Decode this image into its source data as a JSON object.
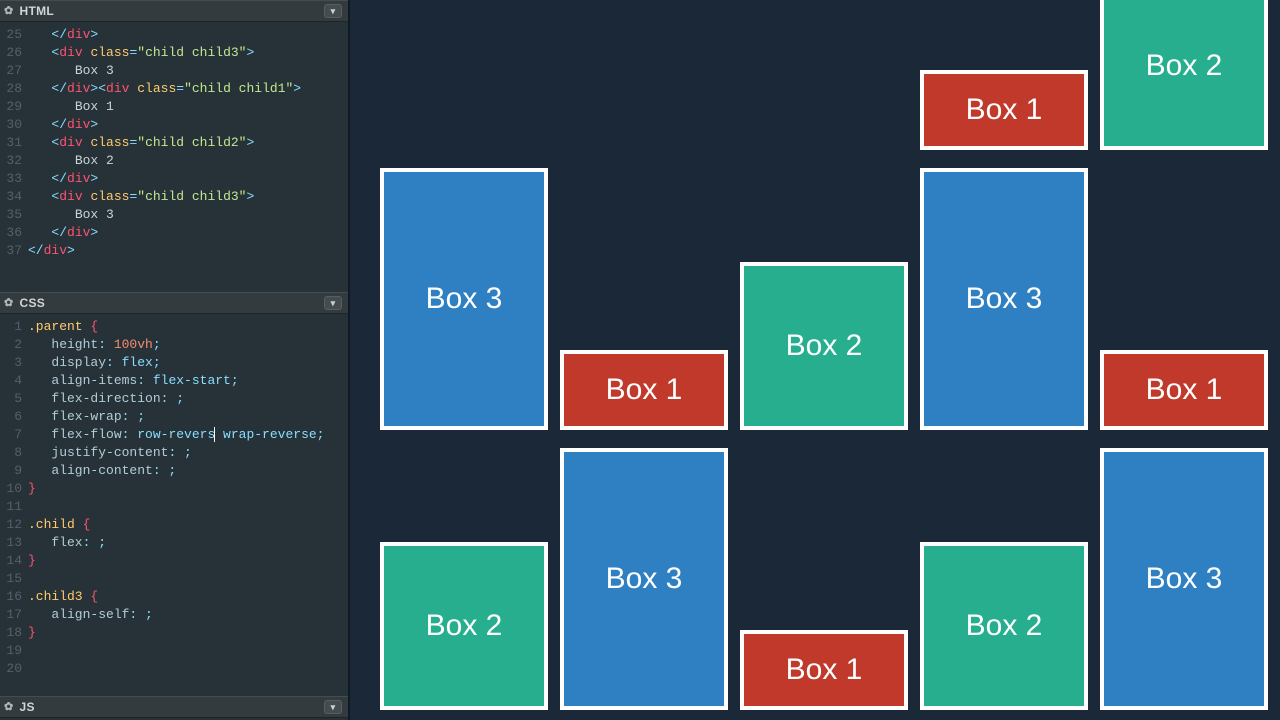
{
  "panels": {
    "html": {
      "title": "HTML"
    },
    "css": {
      "title": "CSS"
    },
    "js": {
      "title": "JS"
    }
  },
  "htmlLines": [
    {
      "n": "25",
      "indent": 1,
      "parts": [
        {
          "c": "punc",
          "t": "</"
        },
        {
          "c": "tag",
          "t": "div"
        },
        {
          "c": "punc",
          "t": ">"
        }
      ]
    },
    {
      "n": "26",
      "indent": 1,
      "parts": [
        {
          "c": "punc",
          "t": "<"
        },
        {
          "c": "tag",
          "t": "div"
        },
        {
          "c": "txt",
          "t": " "
        },
        {
          "c": "attr",
          "t": "class"
        },
        {
          "c": "punc",
          "t": "="
        },
        {
          "c": "str",
          "t": "\"child child3\""
        },
        {
          "c": "punc",
          "t": ">"
        }
      ]
    },
    {
      "n": "27",
      "indent": 2,
      "parts": [
        {
          "c": "txt",
          "t": "Box 3"
        }
      ]
    },
    {
      "n": "28",
      "indent": 1,
      "parts": [
        {
          "c": "punc",
          "t": "</"
        },
        {
          "c": "tag",
          "t": "div"
        },
        {
          "c": "punc",
          "t": "><"
        },
        {
          "c": "tag",
          "t": "div"
        },
        {
          "c": "txt",
          "t": " "
        },
        {
          "c": "attr",
          "t": "class"
        },
        {
          "c": "punc",
          "t": "="
        },
        {
          "c": "str",
          "t": "\"child child1\""
        },
        {
          "c": "punc",
          "t": ">"
        }
      ]
    },
    {
      "n": "29",
      "indent": 2,
      "parts": [
        {
          "c": "txt",
          "t": "Box 1"
        }
      ]
    },
    {
      "n": "30",
      "indent": 1,
      "parts": [
        {
          "c": "punc",
          "t": "</"
        },
        {
          "c": "tag",
          "t": "div"
        },
        {
          "c": "punc",
          "t": ">"
        }
      ]
    },
    {
      "n": "31",
      "indent": 1,
      "parts": [
        {
          "c": "punc",
          "t": "<"
        },
        {
          "c": "tag",
          "t": "div"
        },
        {
          "c": "txt",
          "t": " "
        },
        {
          "c": "attr",
          "t": "class"
        },
        {
          "c": "punc",
          "t": "="
        },
        {
          "c": "str",
          "t": "\"child child2\""
        },
        {
          "c": "punc",
          "t": ">"
        }
      ]
    },
    {
      "n": "32",
      "indent": 2,
      "parts": [
        {
          "c": "txt",
          "t": "Box 2"
        }
      ]
    },
    {
      "n": "33",
      "indent": 1,
      "parts": [
        {
          "c": "punc",
          "t": "</"
        },
        {
          "c": "tag",
          "t": "div"
        },
        {
          "c": "punc",
          "t": ">"
        }
      ]
    },
    {
      "n": "34",
      "indent": 1,
      "parts": [
        {
          "c": "punc",
          "t": "<"
        },
        {
          "c": "tag",
          "t": "div"
        },
        {
          "c": "txt",
          "t": " "
        },
        {
          "c": "attr",
          "t": "class"
        },
        {
          "c": "punc",
          "t": "="
        },
        {
          "c": "str",
          "t": "\"child child3\""
        },
        {
          "c": "punc",
          "t": ">"
        }
      ]
    },
    {
      "n": "35",
      "indent": 2,
      "parts": [
        {
          "c": "txt",
          "t": "Box 3"
        }
      ]
    },
    {
      "n": "36",
      "indent": 1,
      "parts": [
        {
          "c": "punc",
          "t": "</"
        },
        {
          "c": "tag",
          "t": "div"
        },
        {
          "c": "punc",
          "t": ">"
        }
      ]
    },
    {
      "n": "37",
      "indent": 0,
      "parts": [
        {
          "c": "punc",
          "t": "</"
        },
        {
          "c": "tag",
          "t": "div"
        },
        {
          "c": "punc",
          "t": ">"
        }
      ]
    }
  ],
  "cssLines": [
    {
      "n": "1",
      "indent": 0,
      "parts": [
        {
          "c": "sel",
          "t": ".parent"
        },
        {
          "c": "txt",
          "t": " "
        },
        {
          "c": "tag",
          "t": "{"
        }
      ]
    },
    {
      "n": "2",
      "indent": 1,
      "parts": [
        {
          "c": "prop",
          "t": "height"
        },
        {
          "c": "punc",
          "t": ": "
        },
        {
          "c": "num",
          "t": "100vh"
        },
        {
          "c": "punc",
          "t": ";"
        }
      ]
    },
    {
      "n": "3",
      "indent": 1,
      "parts": [
        {
          "c": "prop",
          "t": "display"
        },
        {
          "c": "punc",
          "t": ": "
        },
        {
          "c": "val",
          "t": "flex"
        },
        {
          "c": "punc",
          "t": ";"
        }
      ]
    },
    {
      "n": "4",
      "indent": 1,
      "parts": [
        {
          "c": "prop",
          "t": "align-items"
        },
        {
          "c": "punc",
          "t": ": "
        },
        {
          "c": "val",
          "t": "flex-start"
        },
        {
          "c": "punc",
          "t": ";"
        }
      ]
    },
    {
      "n": "5",
      "indent": 1,
      "parts": [
        {
          "c": "prop",
          "t": "flex-direction"
        },
        {
          "c": "punc",
          "t": ": ;"
        }
      ]
    },
    {
      "n": "6",
      "indent": 1,
      "parts": [
        {
          "c": "prop",
          "t": "flex-wrap"
        },
        {
          "c": "punc",
          "t": ": ;"
        }
      ]
    },
    {
      "n": "7",
      "indent": 1,
      "parts": [
        {
          "c": "prop",
          "t": "flex-flow"
        },
        {
          "c": "punc",
          "t": ": "
        },
        {
          "c": "val",
          "t": "row-revers"
        },
        {
          "c": "cursor",
          "t": ""
        },
        {
          "c": "val",
          "t": " wrap-reverse"
        },
        {
          "c": "punc",
          "t": ";"
        }
      ]
    },
    {
      "n": "8",
      "indent": 1,
      "parts": [
        {
          "c": "prop",
          "t": "justify-content"
        },
        {
          "c": "punc",
          "t": ": ;"
        }
      ]
    },
    {
      "n": "9",
      "indent": 1,
      "parts": [
        {
          "c": "prop",
          "t": "align-content"
        },
        {
          "c": "punc",
          "t": ": ;"
        }
      ]
    },
    {
      "n": "10",
      "indent": 0,
      "parts": [
        {
          "c": "tag",
          "t": "}"
        }
      ]
    },
    {
      "n": "11",
      "indent": 0,
      "parts": []
    },
    {
      "n": "12",
      "indent": 0,
      "parts": [
        {
          "c": "sel",
          "t": ".child"
        },
        {
          "c": "txt",
          "t": " "
        },
        {
          "c": "tag",
          "t": "{"
        }
      ]
    },
    {
      "n": "13",
      "indent": 1,
      "parts": [
        {
          "c": "prop",
          "t": "flex"
        },
        {
          "c": "punc",
          "t": ": ;"
        }
      ]
    },
    {
      "n": "14",
      "indent": 0,
      "parts": [
        {
          "c": "tag",
          "t": "}"
        }
      ]
    },
    {
      "n": "15",
      "indent": 0,
      "parts": []
    },
    {
      "n": "16",
      "indent": 0,
      "parts": [
        {
          "c": "sel",
          "t": ".child3"
        },
        {
          "c": "txt",
          "t": " "
        },
        {
          "c": "tag",
          "t": "{"
        }
      ]
    },
    {
      "n": "17",
      "indent": 1,
      "parts": [
        {
          "c": "prop",
          "t": "align-self"
        },
        {
          "c": "punc",
          "t": ": ;"
        }
      ]
    },
    {
      "n": "18",
      "indent": 0,
      "parts": [
        {
          "c": "tag",
          "t": "}"
        }
      ]
    },
    {
      "n": "19",
      "indent": 0,
      "parts": []
    },
    {
      "n": "20",
      "indent": 0,
      "parts": []
    }
  ],
  "boxes": [
    {
      "cls": "child3",
      "label": "Box 3"
    },
    {
      "cls": "child2",
      "label": "Box 2"
    },
    {
      "cls": "child1",
      "label": "Box 1"
    },
    {
      "cls": "child3",
      "label": "Box 3"
    },
    {
      "cls": "child2",
      "label": "Box 2"
    },
    {
      "cls": "child1",
      "label": "Box 1"
    },
    {
      "cls": "child3",
      "label": "Box 3"
    },
    {
      "cls": "child2",
      "label": "Box 2"
    },
    {
      "cls": "child1",
      "label": "Box 1"
    },
    {
      "cls": "child3",
      "label": "Box 3"
    },
    {
      "cls": "child2",
      "label": "Box 2"
    },
    {
      "cls": "child1",
      "label": "Box 1"
    }
  ]
}
